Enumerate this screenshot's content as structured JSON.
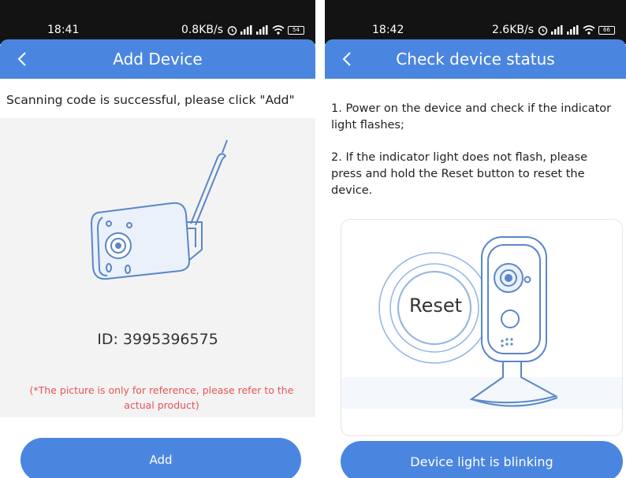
{
  "left": {
    "status": {
      "time": "18:41",
      "speed": "0.8KB/s",
      "battery": "54"
    },
    "header": {
      "title": "Add Device"
    },
    "scan_message": "Scanning code is successful, please click \"Add\"",
    "device_id": "ID: 3995396575",
    "note": "(*The picture is only for reference, please refer to the actual product)",
    "add_button": "Add"
  },
  "right": {
    "status": {
      "time": "18:42",
      "speed": "2.6KB/s",
      "battery": "66"
    },
    "header": {
      "title": "Check device status"
    },
    "steps": [
      "1. Power on the device and check if the indicator light flashes;",
      "2. If the indicator light does not flash, please press and hold the Reset button to reset the device."
    ],
    "reset_label": "Reset",
    "blink_button": "Device light is blinking"
  },
  "colors": {
    "accent": "#4a86e0",
    "status_bar": "#131313",
    "note_red": "#e65454",
    "illustration_blue": "#5a86c8"
  },
  "icons": [
    "back-arrow-icon",
    "alarm-icon",
    "signal-icon",
    "wifi-icon",
    "battery-icon"
  ]
}
